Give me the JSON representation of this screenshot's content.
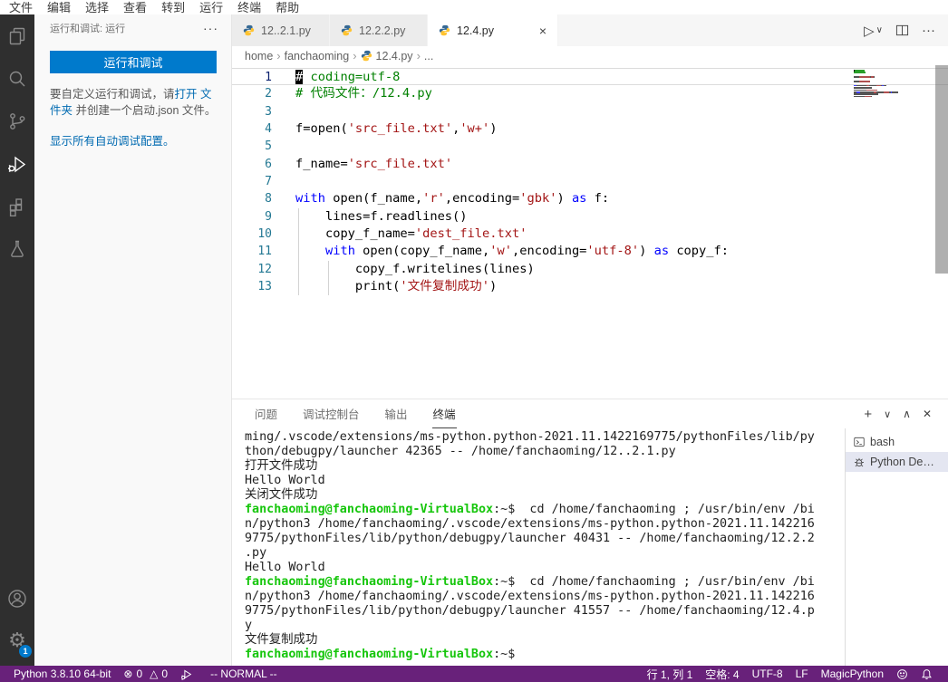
{
  "colors": {
    "accent": "#007acc",
    "status_bg": "#68217a",
    "prompt_green": "#16c60c",
    "python_blue": "#366994",
    "python_yellow": "#ffc331"
  },
  "menu_bar": {
    "items": [
      "文件",
      "编辑",
      "选择",
      "查看",
      "转到",
      "运行",
      "终端",
      "帮助"
    ]
  },
  "activity_bar": {
    "badge": "1",
    "items": [
      "explorer",
      "search",
      "source-control",
      "run-debug",
      "extensions",
      "testing"
    ],
    "bottom_items": [
      "account",
      "settings-gear"
    ],
    "active": "run-debug"
  },
  "sidebar": {
    "header": "运行和调试: 运行",
    "more_actions": "···",
    "run_button": "运行和调试",
    "hint_before": "要自定义运行和调试，请",
    "hint_link": "打开 文件夹",
    "hint_after": " 并创建一个启动.json 文件。",
    "show_configs_link": "显示所有自动调试配置。"
  },
  "editor_tabs": [
    {
      "label": "12..2.1.py",
      "active": false
    },
    {
      "label": "12.2.2.py",
      "active": false
    },
    {
      "label": "12.4.py",
      "active": true,
      "close": "×"
    }
  ],
  "editor_actions": {
    "run": "▷",
    "run_dropdown": "∨",
    "ellipsis": "···"
  },
  "breadcrumb": {
    "items": [
      {
        "label": "home"
      },
      {
        "label": "fanchaoming"
      },
      {
        "label": "12.4.py",
        "icon": true
      },
      {
        "label": "..."
      }
    ],
    "separator": "›"
  },
  "editor": {
    "lines": [
      {
        "num": "1",
        "current": true,
        "tokens": [
          {
            "t": "#",
            "c": "cursor"
          },
          {
            "t": " coding=utf-8",
            "c": "comment"
          }
        ]
      },
      {
        "num": "2",
        "tokens": [
          {
            "t": "# 代码文件：/12.4.py",
            "c": "comment"
          }
        ]
      },
      {
        "num": "3",
        "tokens": []
      },
      {
        "num": "4",
        "tokens": [
          {
            "t": "f=open(",
            "c": "plain"
          },
          {
            "t": "'src_file.txt'",
            "c": "string"
          },
          {
            "t": ",",
            "c": "plain"
          },
          {
            "t": "'w+'",
            "c": "string"
          },
          {
            "t": ")",
            "c": "plain"
          }
        ]
      },
      {
        "num": "5",
        "tokens": []
      },
      {
        "num": "6",
        "tokens": [
          {
            "t": "f_name=",
            "c": "plain"
          },
          {
            "t": "'src_file.txt'",
            "c": "string"
          }
        ]
      },
      {
        "num": "7",
        "tokens": []
      },
      {
        "num": "8",
        "tokens": [
          {
            "t": "with",
            "c": "keyword"
          },
          {
            "t": " open(f_name,",
            "c": "plain"
          },
          {
            "t": "'r'",
            "c": "string"
          },
          {
            "t": ",encoding=",
            "c": "plain"
          },
          {
            "t": "'gbk'",
            "c": "string"
          },
          {
            "t": ") ",
            "c": "plain"
          },
          {
            "t": "as",
            "c": "keyword"
          },
          {
            "t": " f:",
            "c": "plain"
          }
        ]
      },
      {
        "num": "9",
        "guides": [
          0
        ],
        "tokens": [
          {
            "t": "    lines=f.readlines()",
            "c": "plain"
          }
        ]
      },
      {
        "num": "10",
        "guides": [
          0
        ],
        "tokens": [
          {
            "t": "    copy_f_name=",
            "c": "plain"
          },
          {
            "t": "'dest_file.txt'",
            "c": "string"
          }
        ]
      },
      {
        "num": "11",
        "guides": [
          0
        ],
        "tokens": [
          {
            "t": "    ",
            "c": "plain"
          },
          {
            "t": "with",
            "c": "keyword"
          },
          {
            "t": " open(copy_f_name,",
            "c": "plain"
          },
          {
            "t": "'w'",
            "c": "string"
          },
          {
            "t": ",encoding=",
            "c": "plain"
          },
          {
            "t": "'utf-8'",
            "c": "string"
          },
          {
            "t": ") ",
            "c": "plain"
          },
          {
            "t": "as",
            "c": "keyword"
          },
          {
            "t": " copy_f:",
            "c": "plain"
          }
        ]
      },
      {
        "num": "12",
        "guides": [
          0,
          4
        ],
        "tokens": [
          {
            "t": "        copy_f.writelines(lines)",
            "c": "plain"
          }
        ]
      },
      {
        "num": "13",
        "guides": [
          0,
          4
        ],
        "tokens": [
          {
            "t": "        print(",
            "c": "plain"
          },
          {
            "t": "'文件复制成功'",
            "c": "string"
          },
          {
            "t": ")",
            "c": "plain"
          }
        ]
      }
    ]
  },
  "panel": {
    "tabs": [
      {
        "label": "问题"
      },
      {
        "label": "调试控制台"
      },
      {
        "label": "输出"
      },
      {
        "label": "终端",
        "active": true
      }
    ],
    "actions": {
      "new": "+",
      "dropdown": "∨",
      "maximize": "∧",
      "close": "✕"
    },
    "terminal_lines": [
      {
        "tokens": [
          {
            "t": "ming/.vscode/extensions/ms-python.python-2021.11.1422169775/pythonFiles/lib/py",
            "c": "plain"
          }
        ]
      },
      {
        "tokens": [
          {
            "t": "thon/debugpy/launcher 42365 -- /home/fanchaoming/12..2.1.py",
            "c": "plain"
          }
        ]
      },
      {
        "tokens": [
          {
            "t": "打开文件成功",
            "c": "plain"
          }
        ]
      },
      {
        "tokens": [
          {
            "t": "Hello World",
            "c": "plain"
          }
        ]
      },
      {
        "tokens": [
          {
            "t": "关闭文件成功",
            "c": "plain"
          }
        ]
      },
      {
        "tokens": [
          {
            "t": "fanchaoming@fanchaoming-VirtualBox",
            "c": "prompt"
          },
          {
            "t": ":~$  cd /home/fanchaoming ; /usr/bin/env /bi",
            "c": "plain"
          }
        ]
      },
      {
        "tokens": [
          {
            "t": "n/python3 /home/fanchaoming/.vscode/extensions/ms-python.python-2021.11.142216",
            "c": "plain"
          }
        ]
      },
      {
        "tokens": [
          {
            "t": "9775/pythonFiles/lib/python/debugpy/launcher 40431 -- /home/fanchaoming/12.2.2",
            "c": "plain"
          }
        ]
      },
      {
        "tokens": [
          {
            "t": ".py",
            "c": "plain"
          }
        ]
      },
      {
        "tokens": [
          {
            "t": "Hello World",
            "c": "plain"
          }
        ]
      },
      {
        "tokens": [
          {
            "t": "fanchaoming@fanchaoming-VirtualBox",
            "c": "prompt"
          },
          {
            "t": ":~$  cd /home/fanchaoming ; /usr/bin/env /bi",
            "c": "plain"
          }
        ]
      },
      {
        "tokens": [
          {
            "t": "n/python3 /home/fanchaoming/.vscode/extensions/ms-python.python-2021.11.142216",
            "c": "plain"
          }
        ]
      },
      {
        "tokens": [
          {
            "t": "9775/pythonFiles/lib/python/debugpy/launcher 41557 -- /home/fanchaoming/12.4.p",
            "c": "plain"
          }
        ]
      },
      {
        "tokens": [
          {
            "t": "y",
            "c": "plain"
          }
        ]
      },
      {
        "tokens": [
          {
            "t": "文件复制成功",
            "c": "plain"
          }
        ]
      },
      {
        "tokens": [
          {
            "t": "fanchaoming@fanchaoming-VirtualBox",
            "c": "prompt"
          },
          {
            "t": ":~$",
            "c": "plain"
          }
        ]
      }
    ],
    "terminal_list": [
      {
        "icon": "terminal",
        "label": "bash",
        "selected": false
      },
      {
        "icon": "debug-console",
        "label": "Python De…",
        "selected": true
      }
    ]
  },
  "status_bar": {
    "python_version": "Python 3.8.10 64-bit",
    "errors": "0",
    "warnings": "0",
    "error_glyph": "⊗",
    "warning_glyph": "△",
    "vim_mode": "-- NORMAL --",
    "cursor": "行 1, 列 1",
    "spaces": "空格: 4",
    "encoding": "UTF-8",
    "eol": "LF",
    "language": "MagicPython"
  }
}
